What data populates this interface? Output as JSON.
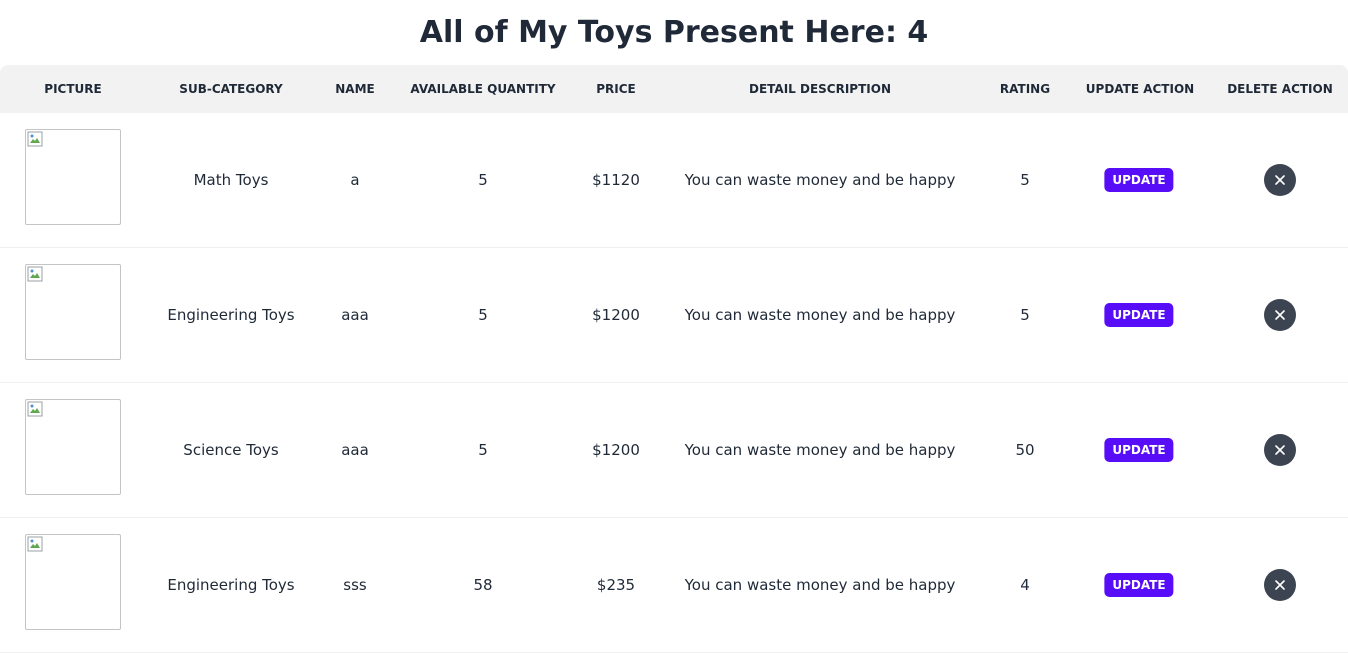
{
  "page": {
    "title": "All of My Toys Present Here: 4"
  },
  "table": {
    "headers": {
      "picture": "PICTURE",
      "sub_category": "SUB-CATEGORY",
      "name": "NAME",
      "available_quantity": "AVAILABLE QUANTITY",
      "price": "PRICE",
      "detail_description": "DETAIL DESCRIPTION",
      "rating": "RATING",
      "update_action": "UPDATE ACTION",
      "delete_action": "DELETE ACTION"
    },
    "rows": [
      {
        "sub_category": "Math Toys",
        "name": "a",
        "quantity": "5",
        "price": "$1120",
        "description": "You can waste money and be happy",
        "rating": "5",
        "update_label": "UPDATE"
      },
      {
        "sub_category": "Engineering Toys",
        "name": "aaa",
        "quantity": "5",
        "price": "$1200",
        "description": "You can waste money and be happy",
        "rating": "5",
        "update_label": "UPDATE"
      },
      {
        "sub_category": "Science Toys",
        "name": "aaa",
        "quantity": "5",
        "price": "$1200",
        "description": "You can waste money and be happy",
        "rating": "50",
        "update_label": "UPDATE"
      },
      {
        "sub_category": "Engineering Toys",
        "name": "sss",
        "quantity": "58",
        "price": "$235",
        "description": "You can waste money and be happy",
        "rating": "4",
        "update_label": "UPDATE"
      }
    ]
  },
  "icons": {
    "picture": "broken-image-icon",
    "delete": "close-icon"
  },
  "colors": {
    "update_button": "#570df8",
    "delete_button": "#3d4451",
    "header_background": "#f2f2f2"
  }
}
